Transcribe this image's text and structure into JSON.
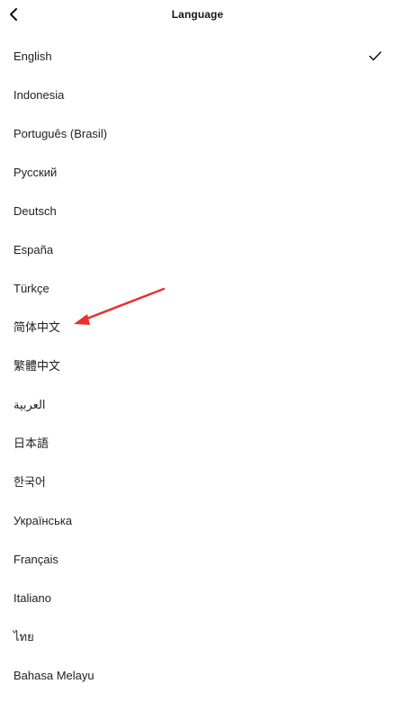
{
  "header": {
    "title": "Language",
    "back_icon": "chevron-left-icon"
  },
  "languages": [
    {
      "label": "English",
      "selected": true
    },
    {
      "label": "Indonesia",
      "selected": false
    },
    {
      "label": "Português (Brasil)",
      "selected": false
    },
    {
      "label": "Русский",
      "selected": false
    },
    {
      "label": "Deutsch",
      "selected": false
    },
    {
      "label": "España",
      "selected": false
    },
    {
      "label": "Türkçe",
      "selected": false
    },
    {
      "label": "简体中文",
      "selected": false
    },
    {
      "label": "繁體中文",
      "selected": false
    },
    {
      "label": "العربية",
      "selected": false
    },
    {
      "label": "日本語",
      "selected": false
    },
    {
      "label": "한국어",
      "selected": false
    },
    {
      "label": "Українська",
      "selected": false
    },
    {
      "label": "Français",
      "selected": false
    },
    {
      "label": "Italiano",
      "selected": false
    },
    {
      "label": "ไทย",
      "selected": false
    },
    {
      "label": "Bahasa Melayu",
      "selected": false
    }
  ],
  "selected_icon": "checkmark-icon",
  "annotation": {
    "type": "red-arrow",
    "color": "#e8322b",
    "points_to": "简体中文"
  }
}
